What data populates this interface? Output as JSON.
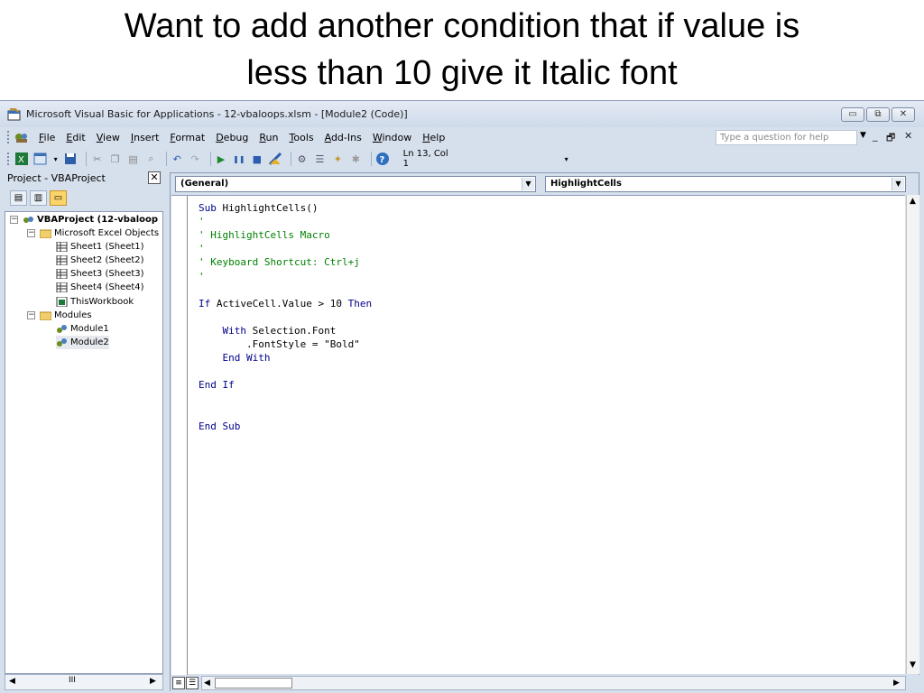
{
  "slide": {
    "title_line1": "Want to add another condition that if value is",
    "title_line2": "less than 10 give it Italic font"
  },
  "window": {
    "title": "Microsoft Visual Basic for Applications - 12-vbaloops.xlsm - [Module2 (Code)]",
    "controls": {
      "minimize": "▭",
      "restore": "⧉",
      "close": "✕"
    }
  },
  "menubar": {
    "items": [
      "File",
      "Edit",
      "View",
      "Insert",
      "Format",
      "Debug",
      "Run",
      "Tools",
      "Add-Ins",
      "Window",
      "Help"
    ],
    "help_placeholder": "Type a question for help",
    "mdi_min": "_",
    "mdi_restore": "🗗",
    "mdi_close": "✕"
  },
  "toolbar": {
    "position": "Ln 13, Col 1",
    "icons": [
      "excel-icon",
      "insert-userform-icon",
      "save-icon",
      "cut-icon",
      "copy-icon",
      "paste-icon",
      "find-icon",
      "undo-icon",
      "redo-icon",
      "run-icon",
      "break-icon",
      "reset-icon",
      "design-mode-icon",
      "project-explorer-icon",
      "properties-icon",
      "object-browser-icon",
      "toolbox-icon",
      "help-icon"
    ]
  },
  "project_pane": {
    "title": "Project - VBAProject",
    "close_glyph": "✕",
    "tree": {
      "root": "VBAProject (12-vbaloop",
      "excel_objects": "Microsoft Excel Objects",
      "sheets": [
        "Sheet1 (Sheet1)",
        "Sheet2 (Sheet2)",
        "Sheet3 (Sheet3)",
        "Sheet4 (Sheet4)"
      ],
      "workbook": "ThisWorkbook",
      "modules_folder": "Modules",
      "modules": [
        "Module1",
        "Module2"
      ]
    },
    "hscroll_thumb": "III"
  },
  "code_pane": {
    "object_combo": "(General)",
    "procedure_combo": "HighlightCells",
    "lines": [
      {
        "text": "Sub HighlightCells()",
        "type": "code"
      },
      {
        "text": "'",
        "type": "comment"
      },
      {
        "text": "' HighlightCells Macro",
        "type": "comment"
      },
      {
        "text": "'",
        "type": "comment"
      },
      {
        "text": "' Keyboard Shortcut: Ctrl+j",
        "type": "comment"
      },
      {
        "text": "'",
        "type": "comment"
      },
      {
        "text": "",
        "type": "code"
      },
      {
        "text": "If ActiveCell.Value > 10 Then",
        "type": "code"
      },
      {
        "text": "",
        "type": "code"
      },
      {
        "text": "    With Selection.Font",
        "type": "code"
      },
      {
        "text": "        .FontStyle = \"Bold\"",
        "type": "code"
      },
      {
        "text": "    End With",
        "type": "code"
      },
      {
        "text": "",
        "type": "code"
      },
      {
        "text": "End If",
        "type": "code"
      },
      {
        "text": "",
        "type": "code"
      },
      {
        "text": "",
        "type": "code"
      },
      {
        "text": "End Sub",
        "type": "code"
      }
    ]
  },
  "colors": {
    "keyword": "#00008b",
    "comment": "#008000",
    "chrome": "#d6dfec"
  }
}
